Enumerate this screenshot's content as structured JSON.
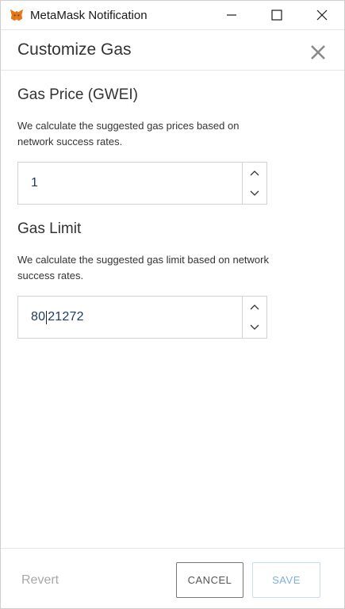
{
  "window": {
    "title": "MetaMask Notification",
    "icon": "metamask-fox-icon",
    "controls": [
      "minimize-icon",
      "maximize-icon",
      "close-icon"
    ]
  },
  "modal": {
    "title": "Customize Gas",
    "close_icon": "close-icon"
  },
  "gas_price": {
    "title": "Gas Price (GWEI)",
    "description": "We calculate the suggested gas prices based on network success rates.",
    "value": "1"
  },
  "gas_limit": {
    "title": "Gas Limit",
    "description": "We calculate the suggested gas limit based on network success rates.",
    "value_before_cursor": "80",
    "value_after_cursor": "21272"
  },
  "footer": {
    "revert_label": "Revert",
    "cancel_label": "CANCEL",
    "save_label": "SAVE"
  },
  "colors": {
    "accent": "#7ab2e0",
    "text": "#333333",
    "input_value": "#1f3a60",
    "disabled": "#a8a8a8",
    "metamask_orange": "#e2761b"
  }
}
